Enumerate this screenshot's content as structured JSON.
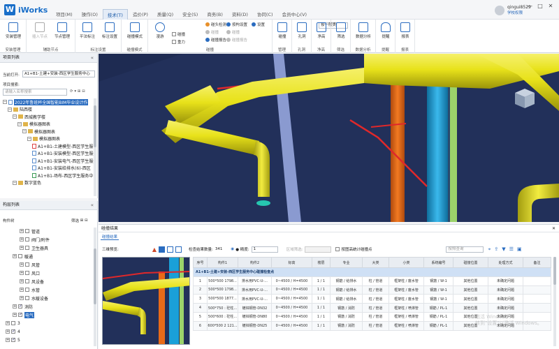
{
  "app": {
    "logo_letter": "W",
    "name": "iWorks"
  },
  "menu": [
    "项目(M)",
    "操作(O)",
    "技术(T)",
    "造价(P)",
    "质量(Q)",
    "安全(S)",
    "商务(B)",
    "资料(D)",
    "协同(C)",
    "会员中心(V)"
  ],
  "menu_active_index": 2,
  "user": {
    "name": "qingui8529",
    "role": "学校权限"
  },
  "window_controls": [
    "—",
    "□",
    "✕"
  ],
  "ribbon": {
    "groups": [
      {
        "label": "安装管理",
        "buttons": [
          "安装管理"
        ]
      },
      {
        "label": "辅助节点",
        "buttons": [
          "插入节点",
          "节点管理"
        ]
      },
      {
        "label": "标注设置",
        "buttons": [
          "平法标注",
          "标注设置"
        ]
      },
      {
        "label": "碰撞模式",
        "buttons": [
          "碰撞模式"
        ]
      },
      {
        "label": "漫游",
        "buttons": [
          "漫游"
        ]
      },
      {
        "label": "碰撞",
        "buttons": []
      },
      {
        "label": "管理",
        "buttons": [
          "碰撞"
        ]
      },
      {
        "label": "孔洞",
        "buttons": [
          "孔洞"
        ]
      },
      {
        "label": "净高",
        "buttons": [
          "净高"
        ]
      },
      {
        "label": "筛选",
        "buttons": [
          "筛选"
        ]
      },
      {
        "label": "数据分析",
        "buttons": [
          "数据分析"
        ]
      },
      {
        "label": "提醒",
        "buttons": [
          "提醒"
        ]
      },
      {
        "label": "报表",
        "buttons": [
          "报表"
        ]
      }
    ],
    "select_value": "按一般类",
    "checks": [
      "碰撞",
      "重力"
    ],
    "small_items": [
      "碰头检测",
      "碰撞",
      "碰撞报告",
      "按构设置",
      "碰撞",
      "碰撞报告",
      "设置"
    ]
  },
  "project_panel": {
    "title": "项目列表",
    "current_label": "当前打开:",
    "current_value": "A1+B1-土建+安装-西区学生服务中心",
    "search_label": "项目搜索:",
    "search_placeholder": "请输入名称搜索",
    "tree": [
      {
        "label": "2022年鲁班杯全国智能BIM毕业设计作",
        "indent": 0,
        "icon": "doc",
        "selected": true
      },
      {
        "label": "陆西楼",
        "indent": 1,
        "icon": "fold"
      },
      {
        "label": "西城教学楼",
        "indent": 2,
        "icon": "fold"
      },
      {
        "label": "模拟器图表",
        "indent": 3,
        "icon": "fold"
      },
      {
        "label": "模拟器图表",
        "indent": 4,
        "icon": "fold"
      },
      {
        "label": "模拟器图表",
        "indent": 5,
        "icon": "fold"
      },
      {
        "label": "A1+B1-土建模型-西区学生服",
        "indent": 6,
        "icon": "red"
      },
      {
        "label": "A1+B1-安装模型-西区学生服务中",
        "indent": 6,
        "icon": "doc"
      },
      {
        "label": "A1+B1-安装电气-西区学生服务",
        "indent": 6,
        "icon": "doc"
      },
      {
        "label": "A1+B1-安装给排水(6)-西区",
        "indent": 6,
        "icon": "doc"
      },
      {
        "label": "A1+B1-场布-西区学生服务中",
        "indent": 6,
        "icon": "green"
      },
      {
        "label": "数字蓝色",
        "indent": 2,
        "icon": "fold"
      }
    ]
  },
  "layer_panel": {
    "title": "构层列表",
    "tree_label": "构件树",
    "filter_label": "筛选",
    "items": [
      {
        "label": "管道",
        "indent": 1,
        "checked": false
      },
      {
        "label": "阀门/附件",
        "indent": 1,
        "checked": false
      },
      {
        "label": "卫生器具",
        "indent": 1,
        "checked": false
      },
      {
        "label": "暖通",
        "indent": 0,
        "checked": false
      },
      {
        "label": "风管",
        "indent": 1,
        "checked": false
      },
      {
        "label": "风口",
        "indent": 1,
        "checked": false
      },
      {
        "label": "风设备",
        "indent": 1,
        "checked": false
      },
      {
        "label": "水管",
        "indent": 1,
        "checked": false
      },
      {
        "label": "水暖设备",
        "indent": 1,
        "checked": false
      },
      {
        "label": "消防",
        "indent": 0,
        "checked": true
      },
      {
        "label": "电气",
        "indent": 0,
        "checked": true,
        "selected": true
      },
      {
        "label": "3",
        "indent": -1,
        "checked": false
      },
      {
        "label": "4",
        "indent": -1,
        "checked": true
      },
      {
        "label": "5",
        "indent": -1,
        "checked": true
      }
    ]
  },
  "results": {
    "title": "碰撞结果",
    "tab": "碰撞结果",
    "preview_label": "三维预览:",
    "count_label": "检查结果数量:",
    "count_value": "341",
    "type_label": "● 精度:",
    "type_value": "1",
    "filter_label": "区域筛选:",
    "checkbox_label": "按图高统计碰撞点",
    "search_placeholder": "按照查询",
    "columns": [
      "序号",
      "构件1",
      "构件2",
      "标高",
      "楼层",
      "专业",
      "大类",
      "小类",
      "系统编号",
      "碰撞位置",
      "处理方式",
      "备注"
    ],
    "group_label": "A1+B1-土建+安装-西区学生服务中心碰撞检查点",
    "rows": [
      [
        "1",
        "500*500 1798...",
        "排水用PVC-U-...",
        "0~4500 / H=4500",
        "1 / 1",
        "钢筋 / 给排水",
        "柱 / 管道",
        "框架柱 / 废水管",
        "钢筋 / W-1",
        "其他位置",
        "未确定问题",
        ""
      ],
      [
        "2",
        "500*500 1798...",
        "排水用PVC-U-...",
        "0~4500 / H=4500",
        "1 / 1",
        "钢筋 / 给排水",
        "柱 / 管道",
        "框架柱 / 废水管",
        "钢筋 / W-1",
        "其他位置",
        "未确定问题",
        ""
      ],
      [
        "3",
        "500*500 1877...",
        "排水用PVC-U-...",
        "0~4500 / H=4500",
        "1 / 1",
        "钢筋 / 给排水",
        "柱 / 管道",
        "框架柱 / 废水管",
        "钢筋 / W-1",
        "其他位置",
        "未确定问题",
        ""
      ],
      [
        "4",
        "500*750 : 砼柱...",
        "镀锌钢管-DN32",
        "0~4500 / H=4500",
        "1 / 1",
        "钢筋 / 消防",
        "柱 / 管道",
        "框架柱 / 喷淋管",
        "钢筋 / PL-1",
        "其他位置",
        "未确定问题",
        ""
      ],
      [
        "5",
        "500*600 : 砼柱...",
        "镀锌钢管-DN80",
        "0~4500 / H=4500",
        "1 / 1",
        "钢筋 / 消防",
        "柱 / 管道",
        "框架柱 / 喷淋管",
        "钢筋 / PL-1",
        "其他位置",
        "未确定问题",
        ""
      ],
      [
        "6",
        "600*500 2 121...",
        "镀锌钢管-DN25",
        "0~4500 / H=4500",
        "1 / 1",
        "钢筋 / 消防",
        "柱 / 管道",
        "框架柱 / 喷淋管",
        "钢筋 / PL-1",
        "其他位置",
        "未确定问题",
        ""
      ]
    ]
  },
  "watermark": {
    "line1": "激活 Windows",
    "line2": "转到\"设置\"以激活 Windows。"
  },
  "colors": {
    "accent": "#2a6cc0",
    "viewport_bg": "#22305a",
    "pipe_yellow": "#e8e21a",
    "pipe_red": "#e0282a",
    "pipe_orange": "#e86a18",
    "pipe_cyan": "#1aa0d8",
    "pipe_green": "#9bd36a",
    "column_blue": "#8a9ad0"
  }
}
